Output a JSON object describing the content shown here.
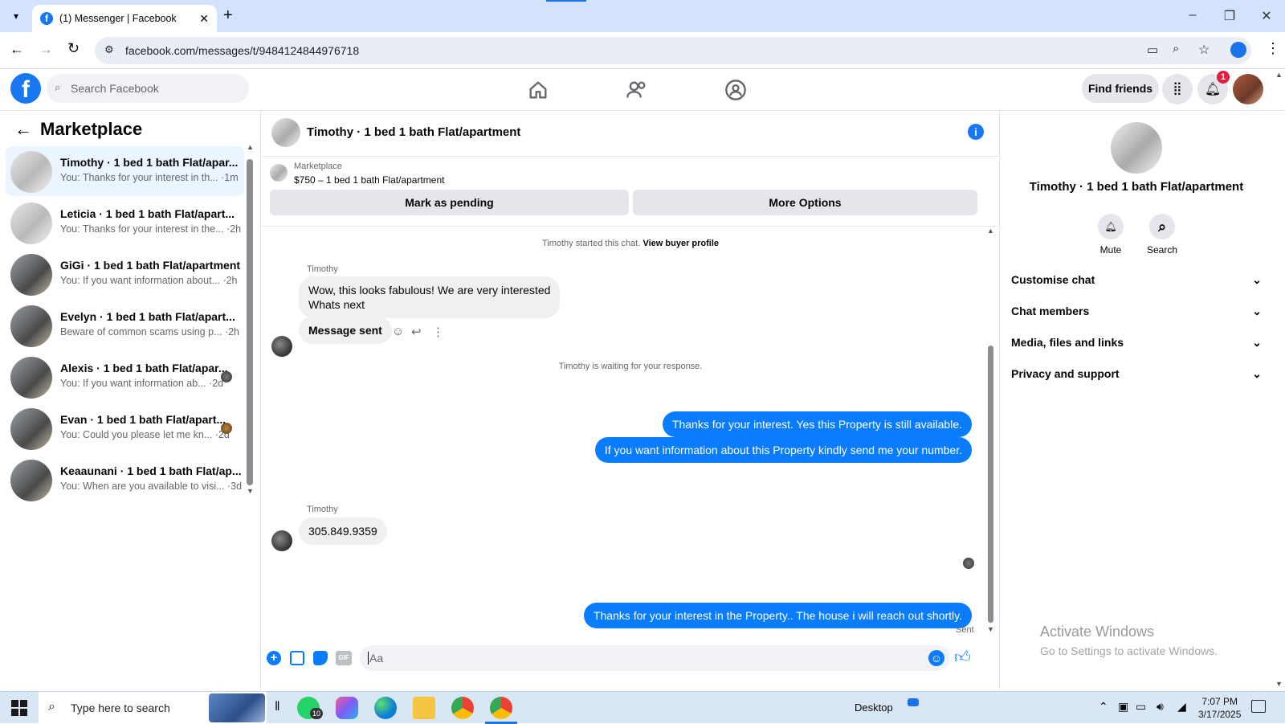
{
  "browser": {
    "tab_title": "(1) Messenger | Facebook",
    "url": "facebook.com/messages/t/9484124844976718"
  },
  "header": {
    "search_placeholder": "Search Facebook",
    "find_friends": "Find friends",
    "notification_count": "1"
  },
  "sidebar": {
    "title": "Marketplace",
    "conversations": [
      {
        "title": "Timothy · 1 bed 1 bath Flat/apar...",
        "preview": "You: Thanks for your interest in th... ·1m",
        "active": true
      },
      {
        "title": "Leticia · 1 bed 1 bath Flat/apart...",
        "preview": "You: Thanks for your interest in the... ·2h"
      },
      {
        "title": "GiGi · 1 bed 1 bath Flat/apartment",
        "preview": "You: If you want information about... ·2h"
      },
      {
        "title": "Evelyn · 1 bed 1 bath Flat/apart...",
        "preview": "Beware of common scams using p... ·2h"
      },
      {
        "title": "Alexis · 1 bed 1 bath Flat/apar...",
        "preview": "You: If you want information ab... ·2d"
      },
      {
        "title": "Evan · 1 bed 1 bath Flat/apart...",
        "preview": "You: Could you please let me kn... ·2d"
      },
      {
        "title": "Keaaunani · 1 bed 1 bath Flat/ap...",
        "preview": "You: When are you available to visi... ·3d"
      }
    ]
  },
  "chat": {
    "title": "Timothy · 1 bed 1 bath Flat/apartment",
    "listing_label": "Marketplace",
    "listing_price": "$750 – 1 bed 1 bath Flat/apartment",
    "mark_pending": "Mark as pending",
    "more_options": "More Options",
    "started_text": "Timothy started this chat.",
    "view_profile": "View buyer profile",
    "sender_name": "Timothy",
    "msg1_line1": "Wow, this looks fabulous! We are very interested",
    "msg1_line2": "Whats next",
    "msg2": "Message sent",
    "waiting": "Timothy is waiting for your response.",
    "out1": "Thanks for your interest. Yes this Property is still available.",
    "out2": "If you want information about this Property kindly send me your number.",
    "msg3": "305.849.9359",
    "out3": "Thanks for your interest in the Property.. The house i will reach  out shortly.",
    "status": "Sent",
    "input_placeholder": "Aa"
  },
  "details": {
    "title": "Timothy · 1 bed 1 bath Flat/apartment",
    "mute": "Mute",
    "search": "Search",
    "sections": [
      "Customise chat",
      "Chat members",
      "Media, files and links",
      "Privacy and support"
    ]
  },
  "watermark": {
    "line1": "Activate Windows",
    "line2": "Go to Settings to activate Windows."
  },
  "taskbar": {
    "search_placeholder": "Type here to search",
    "whatsapp_badge": "10",
    "desktop_label": "Desktop",
    "time": "7:07 PM",
    "date": "3/17/2025"
  },
  "colors": {
    "brand": "#1877f2",
    "outgoing_bubble": "#0a7cff",
    "active_conversation": "#ebf5ff"
  }
}
